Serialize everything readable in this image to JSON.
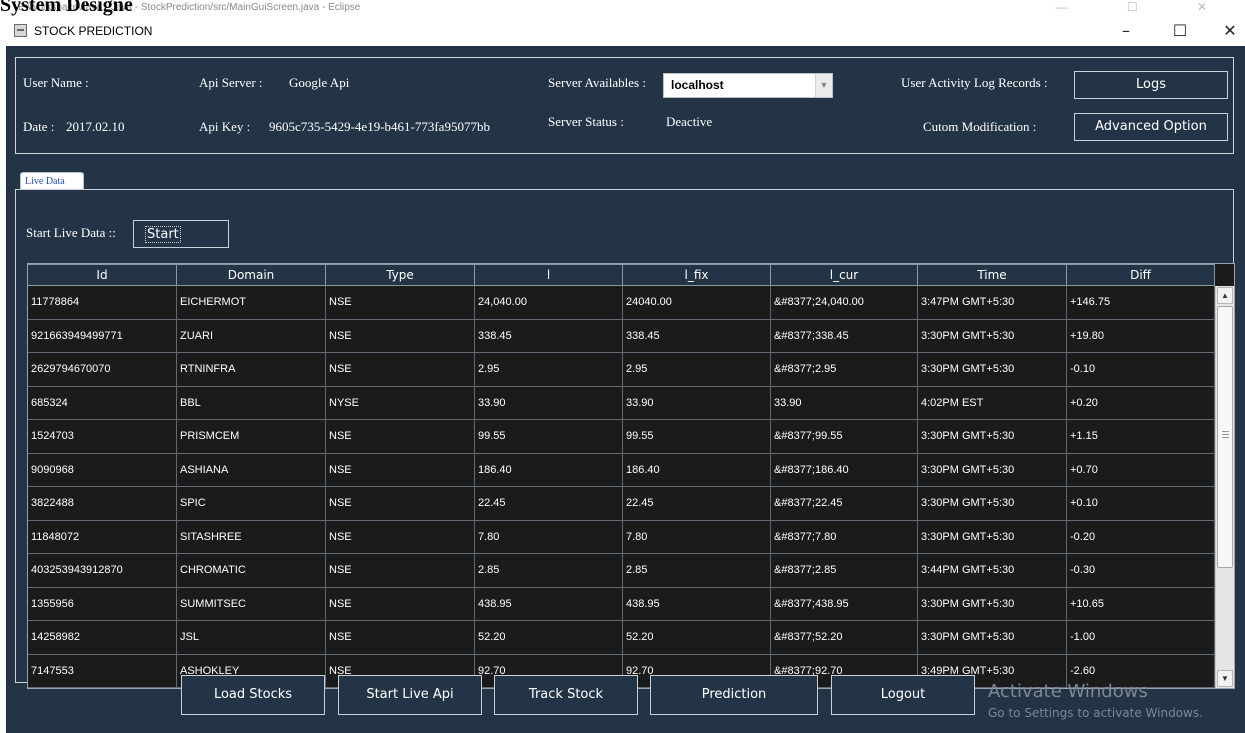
{
  "eclipse": {
    "title": "E:\\workspace\\Java - Java - StockPrediction/src/MainGuiScreen.java - Eclipse",
    "caption": "System Designe"
  },
  "window": {
    "title": "STOCK PREDICTION",
    "minimize_glyph": "–",
    "maximize_glyph": "☐",
    "close_glyph": "✕"
  },
  "header": {
    "user_name_label": "User Name :",
    "date_label": "Date :",
    "date_value": "2017.02.10",
    "api_server_label": "Api Server :",
    "api_server_value": "Google Api",
    "api_key_label": "Api Key :",
    "api_key_value": "9605c735-5429-4e19-b461-773fa95077bb",
    "server_available_label": "Server Availables :",
    "server_available_value": "localhost",
    "server_status_label": "Server Status :",
    "server_status_value": "Deactive",
    "activity_log_label": "User Activity Log Records :",
    "logs_button": "Logs",
    "custom_mod_label": "Cutom Modification :",
    "advanced_button": "Advanced Option"
  },
  "tab": {
    "label": "Live Data"
  },
  "live": {
    "start_label": "Start Live Data ::",
    "start_button": "Start"
  },
  "table": {
    "columns": [
      "Id",
      "Domain",
      "Type",
      "l",
      "l_fix",
      "l_cur",
      "Time",
      "Diff"
    ],
    "rows": [
      [
        "11778864",
        "EICHERMOT",
        "NSE",
        "24,040.00",
        "24040.00",
        "&#8377;24,040.00",
        "3:47PM GMT+5:30",
        "+146.75"
      ],
      [
        "921663949499771",
        "ZUARI",
        "NSE",
        "338.45",
        "338.45",
        "&#8377;338.45",
        "3:30PM GMT+5:30",
        "+19.80"
      ],
      [
        "2629794670070",
        "RTNINFRA",
        "NSE",
        "2.95",
        "2.95",
        "&#8377;2.95",
        "3:30PM GMT+5:30",
        "-0.10"
      ],
      [
        "685324",
        "BBL",
        "NYSE",
        "33.90",
        "33.90",
        "33.90",
        "4:02PM EST",
        "+0.20"
      ],
      [
        "1524703",
        "PRISMCEM",
        "NSE",
        "99.55",
        "99.55",
        "&#8377;99.55",
        "3:30PM GMT+5:30",
        "+1.15"
      ],
      [
        "9090968",
        "ASHIANA",
        "NSE",
        "186.40",
        "186.40",
        "&#8377;186.40",
        "3:30PM GMT+5:30",
        "+0.70"
      ],
      [
        "3822488",
        "SPIC",
        "NSE",
        "22.45",
        "22.45",
        "&#8377;22.45",
        "3:30PM GMT+5:30",
        "+0.10"
      ],
      [
        "11848072",
        "SITASHREE",
        "NSE",
        "7.80",
        "7.80",
        "&#8377;7.80",
        "3:30PM GMT+5:30",
        "-0.20"
      ],
      [
        "403253943912870",
        "CHROMATIC",
        "NSE",
        "2.85",
        "2.85",
        "&#8377;2.85",
        "3:44PM GMT+5:30",
        "-0.30"
      ],
      [
        "1355956",
        "SUMMITSEC",
        "NSE",
        "438.95",
        "438.95",
        "&#8377;438.95",
        "3:30PM GMT+5:30",
        "+10.65"
      ],
      [
        "14258982",
        "JSL",
        "NSE",
        "52.20",
        "52.20",
        "&#8377;52.20",
        "3:30PM GMT+5:30",
        "-1.00"
      ],
      [
        "7147553",
        "ASHOKLEY",
        "NSE",
        "92.70",
        "92.70",
        "&#8377;92.70",
        "3:49PM GMT+5:30",
        "-2.60"
      ]
    ]
  },
  "actions": {
    "load_stocks": "Load Stocks",
    "start_live_api": "Start Live Api",
    "track_stock": "Track Stock",
    "prediction": "Prediction",
    "logout": "Logout"
  },
  "watermark": {
    "title": "Activate Windows",
    "subtitle": "Go to Settings to activate Windows."
  },
  "colors": {
    "panel_bg": "#233446",
    "table_bg": "#1b1b1b",
    "border": "#c9d0d6",
    "tab_text": "#2255bb"
  },
  "icons": {
    "app": "window-app-icon",
    "combo": "chevron-down-icon",
    "scroll_up": "arrow-up-icon",
    "scroll_down": "arrow-down-icon"
  }
}
